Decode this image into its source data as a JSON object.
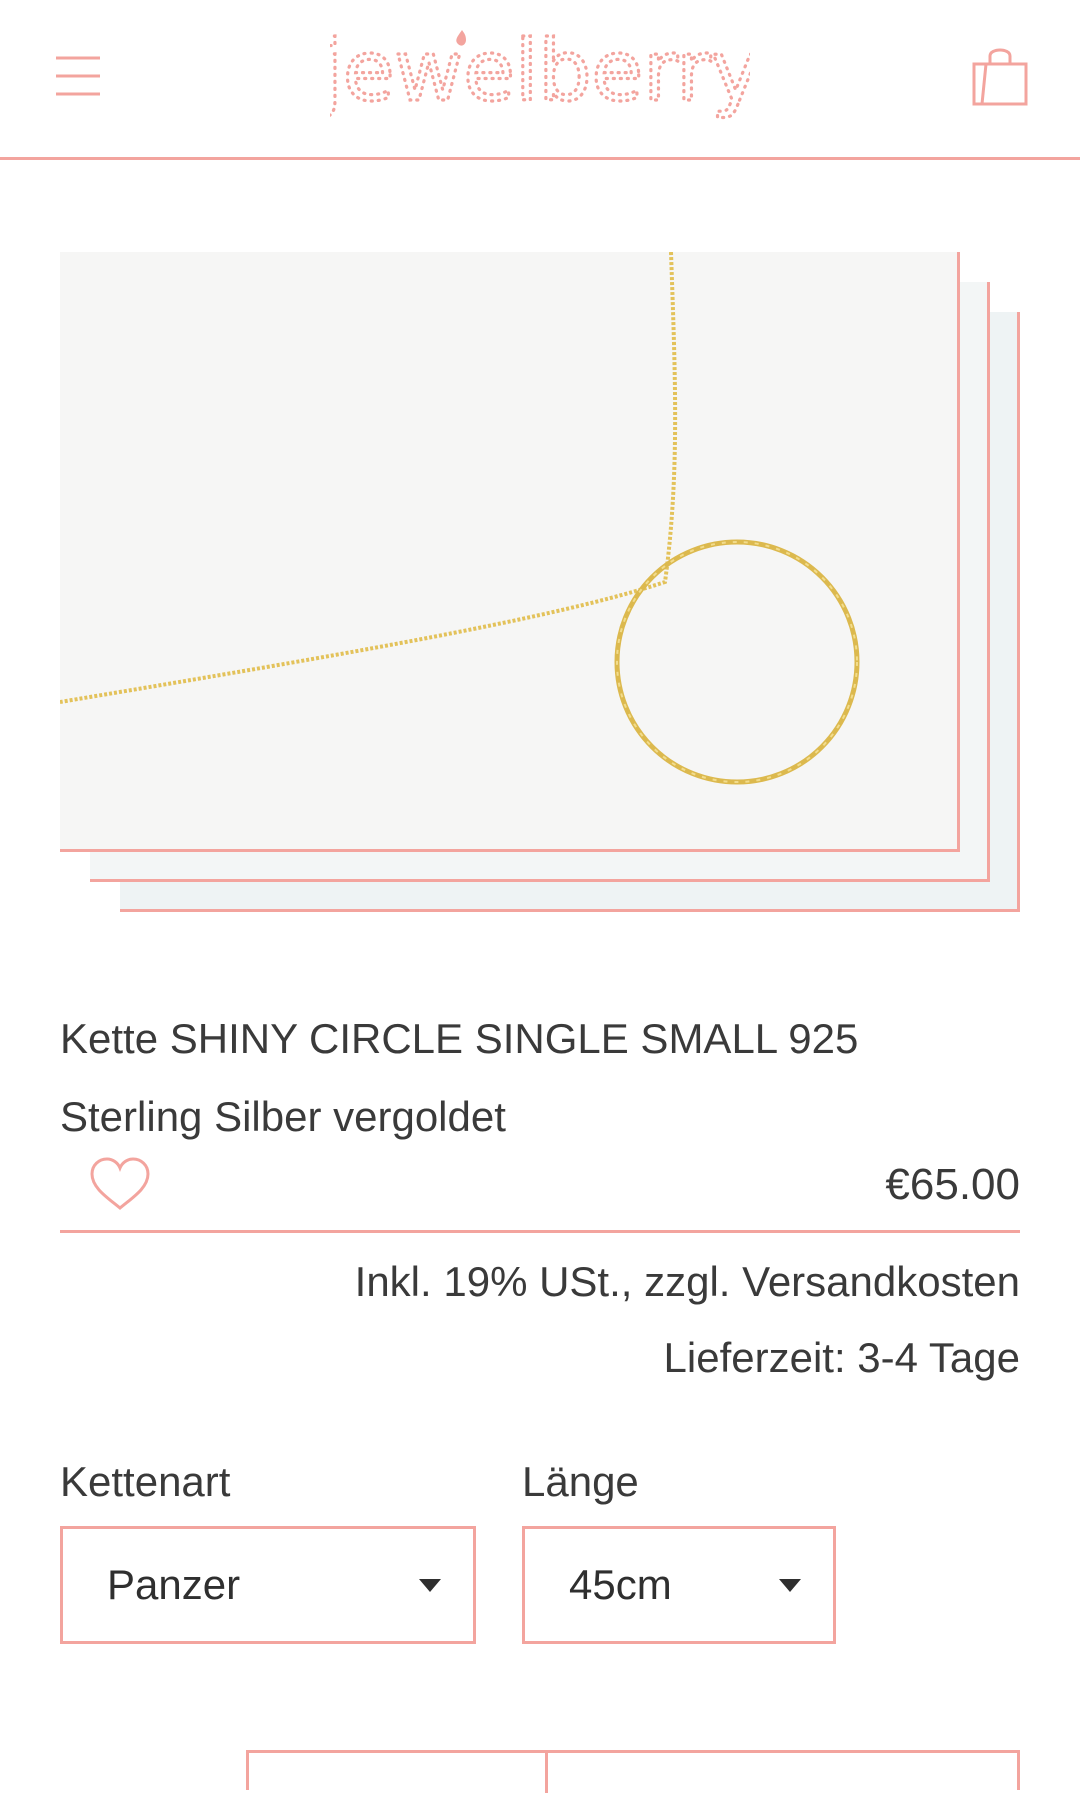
{
  "header": {
    "logo_text": "jewelberry",
    "menu_icon": "hamburger-menu-icon",
    "cart_icon": "shopping-bag-icon"
  },
  "colors": {
    "accent": "#f3a49e",
    "text": "#3a3a3a",
    "photo_bg": "#f6f6f5",
    "gold": "#e3c25a"
  },
  "product": {
    "title_line1": "Kette SHINY CIRCLE SINGLE SMALL 925",
    "title_line2": "Sterling Silber vergoldet",
    "price": "€65.00",
    "tax_note": "Inkl. 19% USt., zzgl. Versandkosten",
    "delivery": "Lieferzeit: 3-4 Tage",
    "wishlist_icon": "heart-outline-icon"
  },
  "options": {
    "chain_type": {
      "label": "Kettenart",
      "selected": "Panzer"
    },
    "length": {
      "label": "Länge",
      "selected": "45cm"
    }
  }
}
